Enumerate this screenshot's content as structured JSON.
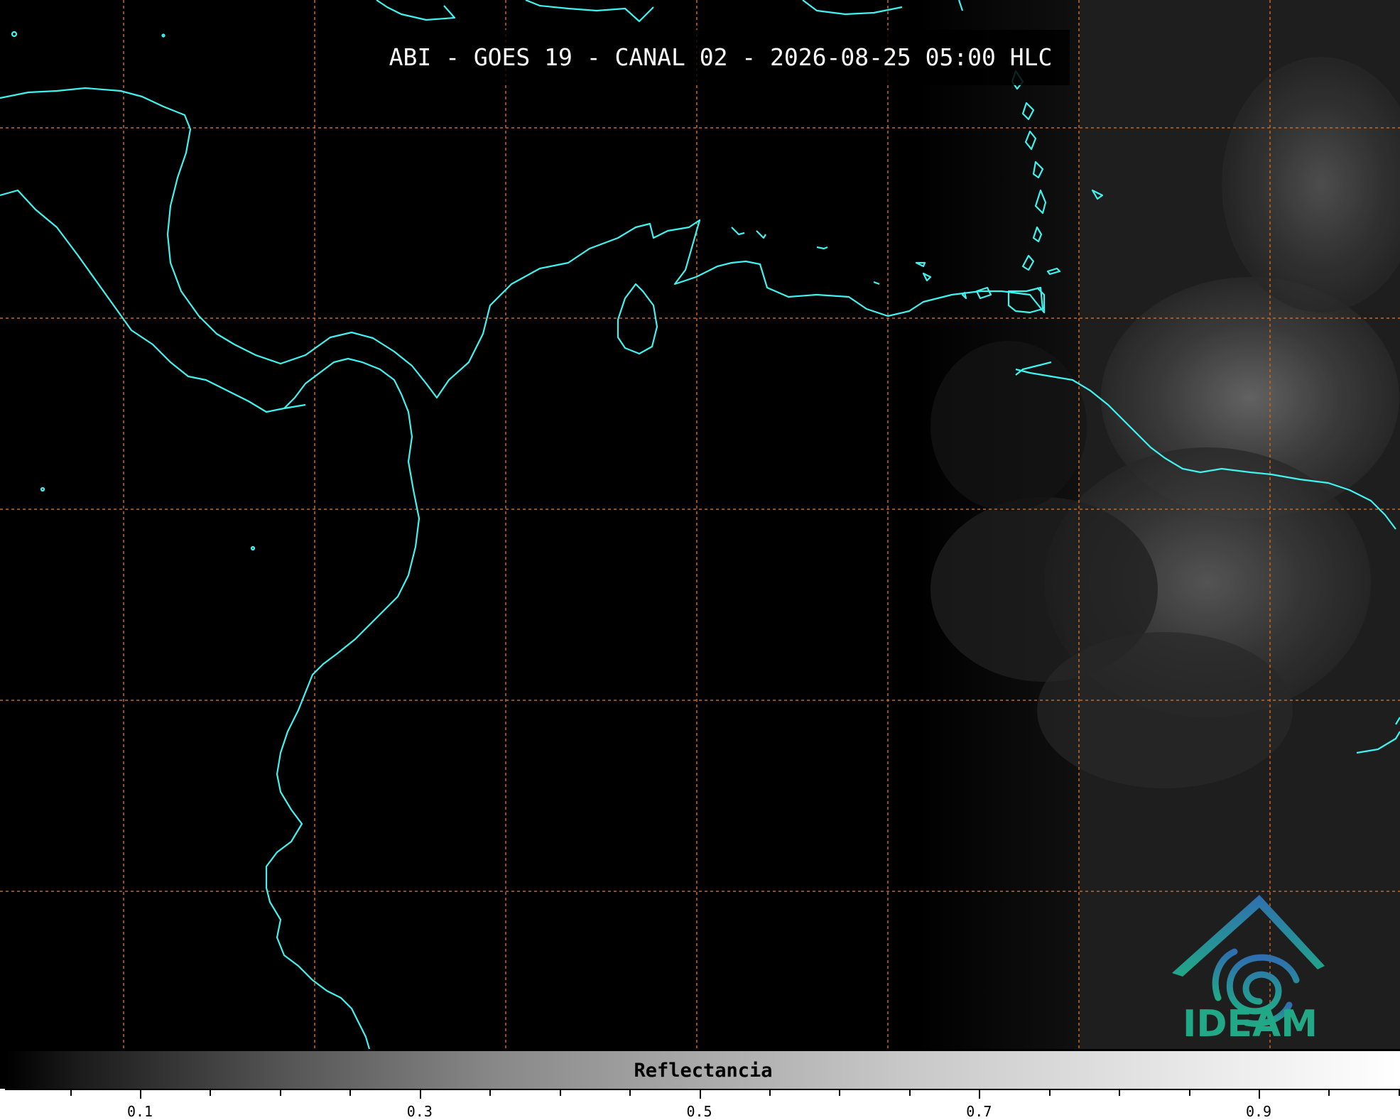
{
  "title": "ABI - GOES 19 - CANAL 02 - 2026-08-25 05:00 HLC",
  "logo_text": "IDEAM",
  "colorbar": {
    "label": "Reflectancia",
    "tick_labels": [
      "0.1",
      "0.3",
      "0.5",
      "0.7",
      "0.9"
    ]
  },
  "colors": {
    "coastline": "#3ff4f0",
    "gridline": "#c46a28",
    "logo_blue": "#2f6fb0",
    "logo_green": "#21a887",
    "background": "#000000"
  }
}
